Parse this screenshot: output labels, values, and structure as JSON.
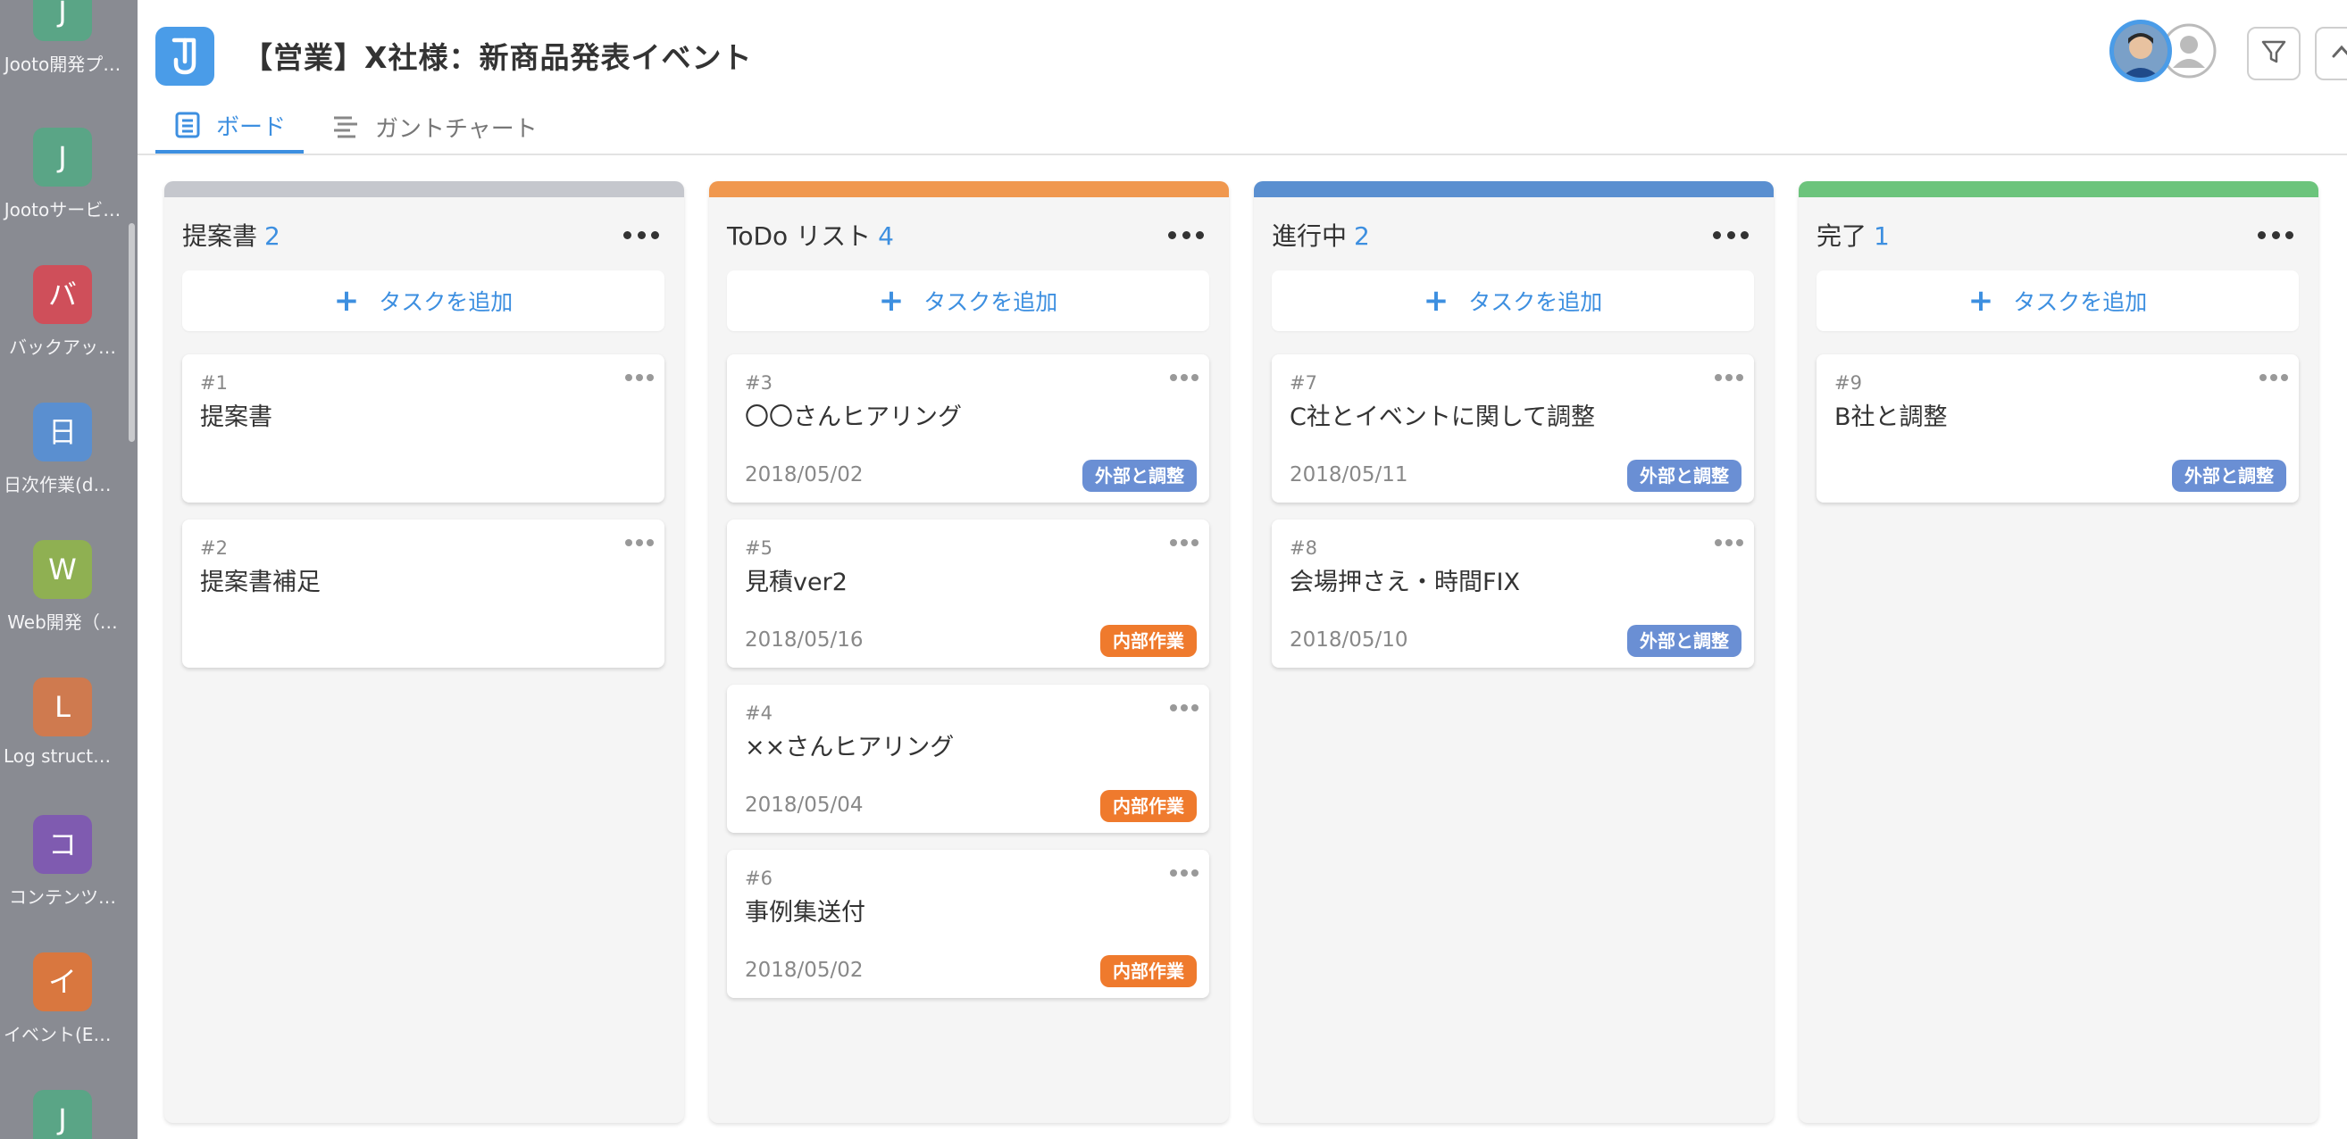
{
  "sidebar": {
    "items": [
      {
        "letter": "J",
        "label": "Jooto開発プ…",
        "color": "#5aa586"
      },
      {
        "letter": "J",
        "label": "Jootoサービ…",
        "color": "#5aa586"
      },
      {
        "letter": "バ",
        "label": "バックアッ…",
        "color": "#cf4f5a"
      },
      {
        "letter": "日",
        "label": "日次作業(dai…",
        "color": "#5a8fd0"
      },
      {
        "letter": "W",
        "label": "Web開発（…",
        "color": "#8fb052"
      },
      {
        "letter": "L",
        "label": "Log structure",
        "color": "#cf7a4f"
      },
      {
        "letter": "コ",
        "label": "コンテンツ…",
        "color": "#7f5bb0"
      },
      {
        "letter": "イ",
        "label": "イベント(Ev…",
        "color": "#d9773f"
      },
      {
        "letter": "J",
        "label": "",
        "color": "#5aa586"
      }
    ]
  },
  "header": {
    "project_title": "【営業】X社様：新商品発表イベント",
    "tabs": [
      {
        "label": "ボード",
        "icon": "board-icon",
        "active": true
      },
      {
        "label": "ガントチャート",
        "icon": "gantt-icon",
        "active": false
      }
    ]
  },
  "board": {
    "add_task_label": "タスクを追加",
    "columns": [
      {
        "name": "提案書",
        "count": "2",
        "color": "#c5c7cd",
        "cards": [
          {
            "num": "#1",
            "title": "提案書",
            "date": "",
            "tag": "",
            "tag_color": ""
          },
          {
            "num": "#2",
            "title": "提案書補足",
            "date": "",
            "tag": "",
            "tag_color": ""
          }
        ]
      },
      {
        "name": "ToDo リスト",
        "count": "4",
        "color": "#f0984f",
        "cards": [
          {
            "num": "#3",
            "title": "〇〇さんヒアリング",
            "date": "2018/05/02",
            "tag": "外部と調整",
            "tag_color": "#6a8fd4"
          },
          {
            "num": "#5",
            "title": "見積ver2",
            "date": "2018/05/16",
            "tag": "内部作業",
            "tag_color": "#ef7a2d"
          },
          {
            "num": "#4",
            "title": "××さんヒアリング",
            "date": "2018/05/04",
            "tag": "内部作業",
            "tag_color": "#ef7a2d"
          },
          {
            "num": "#6",
            "title": "事例集送付",
            "date": "2018/05/02",
            "tag": "内部作業",
            "tag_color": "#ef7a2d"
          }
        ]
      },
      {
        "name": "進行中",
        "count": "2",
        "color": "#5a8fd0",
        "cards": [
          {
            "num": "#7",
            "title": "C社とイベントに関して調整",
            "date": "2018/05/11",
            "tag": "外部と調整",
            "tag_color": "#6a8fd4"
          },
          {
            "num": "#8",
            "title": "会場押さえ・時間FIX",
            "date": "2018/05/10",
            "tag": "外部と調整",
            "tag_color": "#6a8fd4"
          }
        ]
      },
      {
        "name": "完了",
        "count": "1",
        "color": "#6cc47c",
        "cards": [
          {
            "num": "#9",
            "title": "B社と調整",
            "date": "",
            "tag": "外部と調整",
            "tag_color": "#6a8fd4"
          }
        ]
      }
    ]
  }
}
